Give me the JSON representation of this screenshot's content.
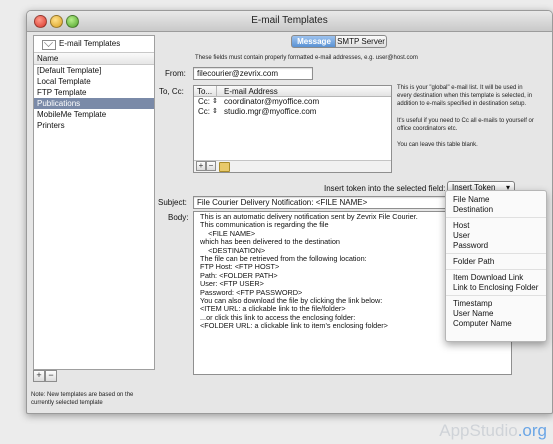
{
  "window": {
    "title": "E-mail Templates"
  },
  "sidebar": {
    "header": "E-mail Templates",
    "column": "Name",
    "items": [
      {
        "label": "[Default Template]"
      },
      {
        "label": "Local Template"
      },
      {
        "label": "FTP Template"
      },
      {
        "label": "Publications",
        "selected": true
      },
      {
        "label": "MobileMe Template"
      },
      {
        "label": "Printers"
      }
    ],
    "note": "Note: New templates are based on the currently selected template",
    "add_label": "+",
    "remove_label": "−"
  },
  "tabs": [
    {
      "label": "Message",
      "active": true
    },
    {
      "label": "SMTP Server",
      "active": false
    }
  ],
  "notice": "These fields must contain properly formatted e-mail addresses, e.g. user@host.com",
  "from": {
    "label": "From:",
    "value": "filecourier@zevrix.com"
  },
  "to_cc": {
    "label": "To, Cc:",
    "columns": [
      "To...",
      "E-mail Address"
    ],
    "rows": [
      {
        "type": "Cc:",
        "address": "coordinator@myoffice.com"
      },
      {
        "type": "Cc:",
        "address": "studio.mgr@myoffice.com"
      }
    ],
    "help": [
      "This is your \"global\" e-mail list. It will be used in every destination when this template is selected, in addition to e-mails specified in destination setup.",
      "It's useful if you need to Cc all e-mails to yourself or office coordinators etc.",
      "You can leave this table blank."
    ]
  },
  "token": {
    "label": "Insert token into the selected field:",
    "button": "Insert Token"
  },
  "subject": {
    "label": "Subject:",
    "value": "File Courier Delivery Notification: <FILE NAME>"
  },
  "body": {
    "label": "Body:",
    "lines": [
      "This is an automatic delivery notification sent by Zevrix File Courier.",
      "",
      "This communication is regarding the file",
      "    <FILE NAME>",
      "which has been delivered to the destination",
      "    <DESTINATION>",
      "",
      "The file can be retrieved from the following location:",
      "",
      "FTP Host: <FTP HOST>",
      "Path: <FOLDER PATH>",
      "User: <FTP USER>",
      "Password: <FTP PASSWORD>",
      "",
      "You can also download the file by clicking the link below:",
      "<ITEM URL: a clickable link to the file/folder>",
      "",
      "...or click this link to access the enclosing folder:",
      "<FOLDER URL: a clickable link to item's enclosing folder>"
    ]
  },
  "token_menu": {
    "groups": [
      [
        "File Name",
        "Destination"
      ],
      [
        "Host",
        "User",
        "Password"
      ],
      [
        "Folder Path"
      ],
      [
        "Item Download Link",
        "Link to Enclosing Folder"
      ],
      [
        "Timestamp",
        "User Name",
        "Computer Name"
      ]
    ]
  },
  "watermark": {
    "left": "AppStudio",
    "right": ".org"
  },
  "colors": {
    "selection": "#7a8aa8",
    "tab_active": "#5a92d3"
  }
}
